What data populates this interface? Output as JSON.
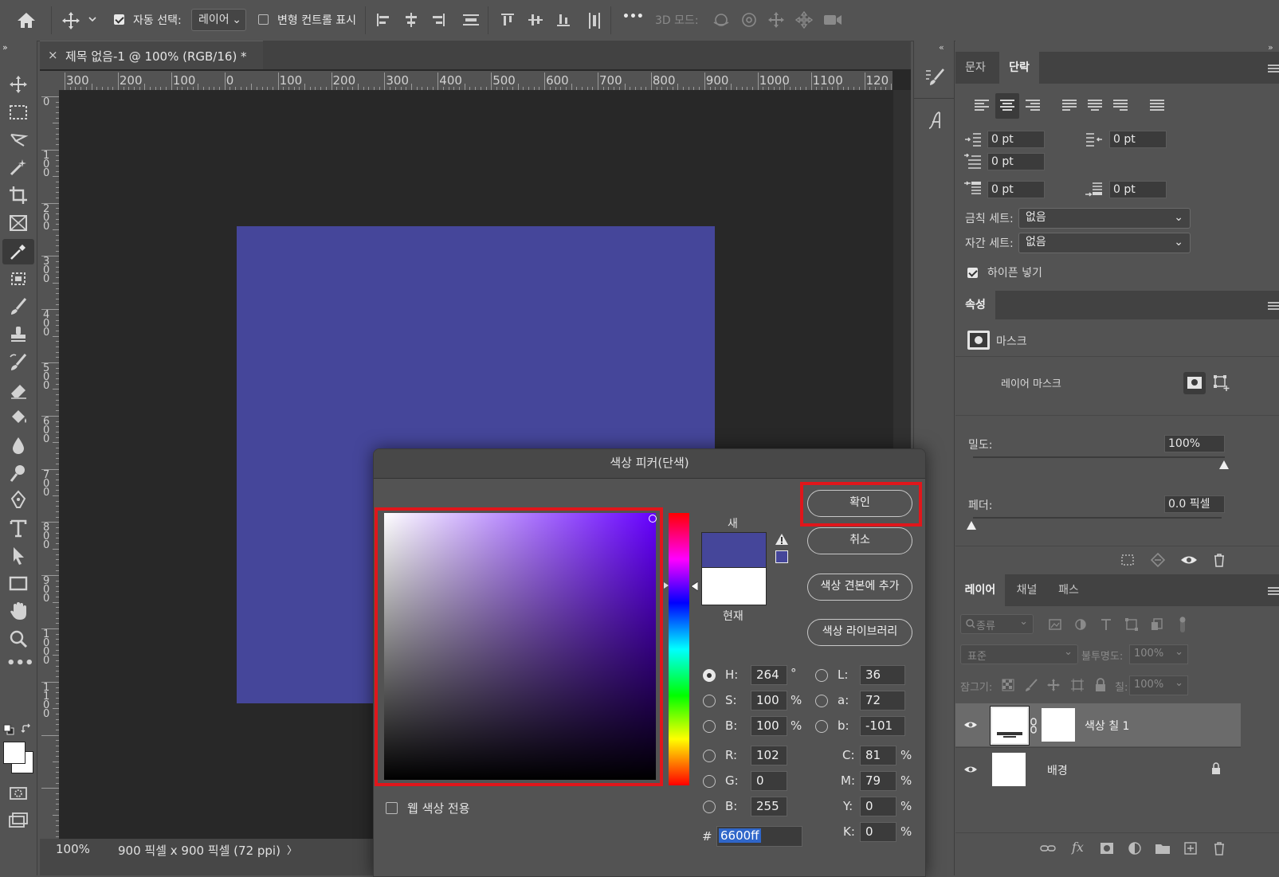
{
  "options_bar": {
    "auto_select_label": "자동 선택:",
    "auto_select_checked": true,
    "auto_select_target": "레이어",
    "transform_controls_label": "변형 컨트롤 표시",
    "transform_controls_checked": false,
    "more_label": "•••",
    "mode_3d_label": "3D 모드:"
  },
  "document": {
    "tab_close": "×",
    "tab_title": "제목 없음-1 @ 100% (RGB/16) *",
    "ruler_top": [
      "300",
      "200",
      "100",
      "0",
      "100",
      "200",
      "300",
      "400",
      "500",
      "600",
      "700",
      "800",
      "900",
      "1000",
      "1100",
      "120"
    ],
    "ruler_left": [
      "0",
      "100",
      "200",
      "300",
      "400",
      "500",
      "600",
      "700",
      "800",
      "900",
      "1000",
      "1100"
    ],
    "canvas_color": "#45469a",
    "zoom": "100%",
    "doc_info": "900 픽셀 x 900 픽셀 (72 ppi)",
    "status_arrow": "〉"
  },
  "paragraph_panel": {
    "tabs": [
      "문자",
      "단락"
    ],
    "active_tab": "단락",
    "indent_left": "0 pt",
    "indent_right": "0 pt",
    "indent_first": "0 pt",
    "space_before": "0 pt",
    "space_after": "0 pt",
    "kinsoku_label": "금칙 세트:",
    "kinsoku_value": "없음",
    "mojikumi_label": "자간 세트:",
    "mojikumi_value": "없음",
    "hyphenate_label": "하이픈 넣기",
    "hyphenate_checked": true
  },
  "properties_panel": {
    "title": "속성",
    "mask_label": "마스크",
    "layer_mask_label": "레이어 마스크",
    "density_label": "밀도:",
    "density_value": "100%",
    "feather_label": "페더:",
    "feather_value": "0.0 픽셀"
  },
  "layers_panel": {
    "tabs": [
      "레이어",
      "채널",
      "패스"
    ],
    "active_tab": "레이어",
    "filter_kind": "종류",
    "blend_mode": "표준",
    "opacity_label": "불투명도:",
    "opacity_value": "100%",
    "lock_label": "잠그기:",
    "fill_label": "칠:",
    "fill_value": "100%",
    "layers": [
      {
        "name": "색상 칠 1",
        "selected": true
      },
      {
        "name": "배경",
        "selected": false
      }
    ]
  },
  "color_picker": {
    "title": "색상 피커(단색)",
    "ok_label": "확인",
    "cancel_label": "취소",
    "add_swatch_label": "색상 견본에 추가",
    "libraries_label": "색상 라이브러리",
    "new_label": "새",
    "current_label": "현재",
    "new_color": "#45469a",
    "current_color": "#ffffff",
    "web_only_label": "웹 색상 전용",
    "web_only_checked": false,
    "hue_degrees": 264,
    "fields": {
      "H": "264",
      "S": "100",
      "B": "100",
      "R": "102",
      "G": "0",
      "B2": "255",
      "L": "36",
      "a": "72",
      "b": "-101",
      "C": "81",
      "M": "79",
      "Y": "0",
      "K": "0"
    },
    "labels": {
      "H": "H:",
      "S": "S:",
      "B": "B:",
      "R": "R:",
      "G": "G:",
      "B2": "B:",
      "L": "L:",
      "a": "a:",
      "b": "b:",
      "C": "C:",
      "M": "M:",
      "Y": "Y:",
      "K": "K:"
    },
    "units": {
      "deg": "°",
      "pct": "%"
    },
    "hex_label": "#",
    "hex": "6600ff",
    "highlight_color": "#e0161b"
  }
}
